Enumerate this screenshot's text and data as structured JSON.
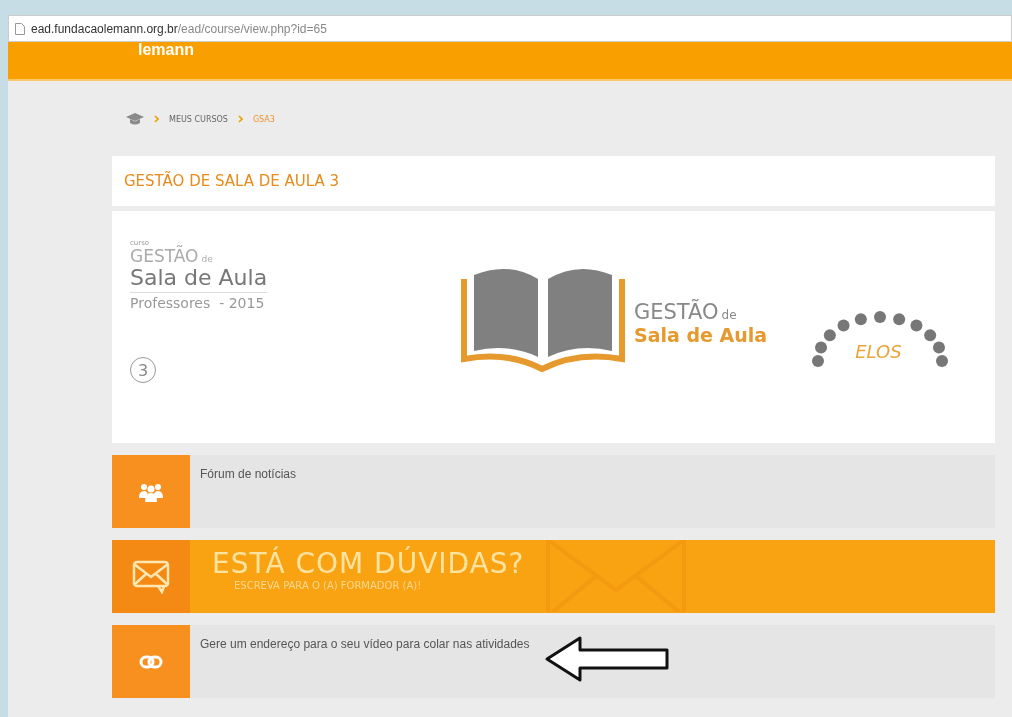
{
  "address_bar": {
    "domain": "ead.fundacaolemann.org.br",
    "path": "/ead/course/view.php?id=65"
  },
  "header": {
    "logo_text": "lemann"
  },
  "breadcrumb": [
    {
      "label": "MEUS CURSOS",
      "current": false
    },
    {
      "label": "GSA3",
      "current": true
    }
  ],
  "course_title": "GESTÃO DE SALA DE AULA 3",
  "banner": {
    "eyebrow": "curso",
    "title_small": "GESTÃO",
    "title_connector": "de",
    "title_large": "Sala de Aula",
    "audience": "Professores  - 2015",
    "module_number": "3",
    "book_title": "GESTÃO",
    "book_connector": "de",
    "book_subtitle": "Sala de Aula",
    "partner_logo_text": "ELOS"
  },
  "activities": [
    {
      "kind": "forum",
      "label": "Fórum de notícias",
      "annotated": false
    },
    {
      "kind": "banner",
      "title": "ESTÁ COM DÚVIDAS?",
      "subtitle": "ESCREVA PARA O (A) FORMADOR (A)!"
    },
    {
      "kind": "link",
      "label": "Gere um endereço para o seu vídeo para colar nas atividades",
      "annotated": true
    }
  ]
}
